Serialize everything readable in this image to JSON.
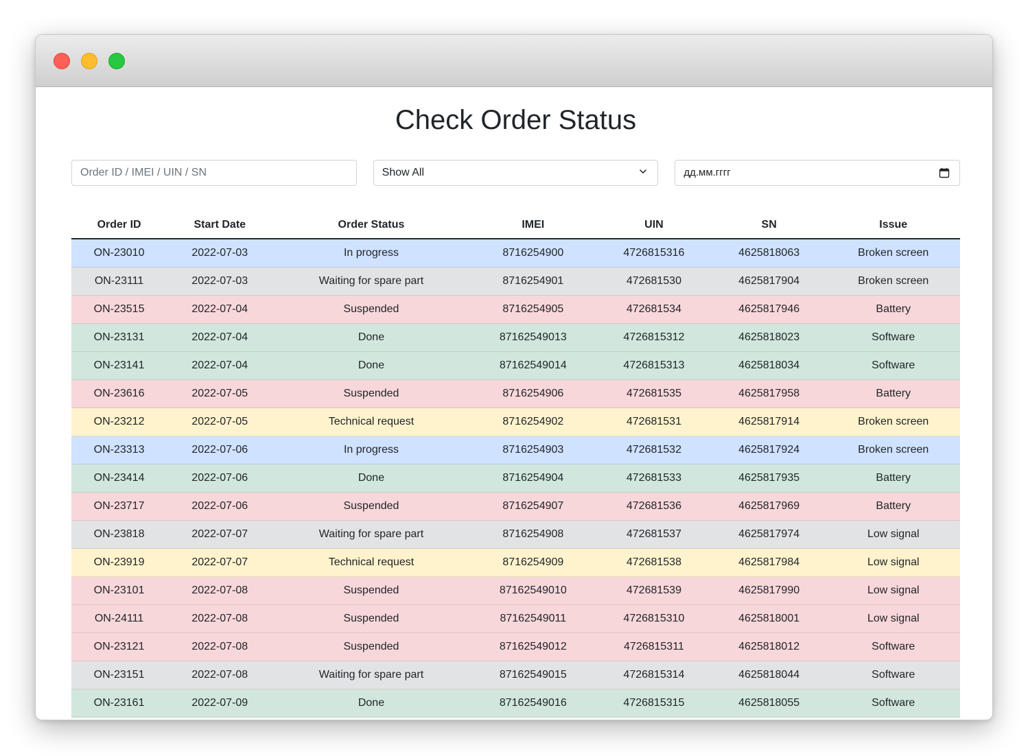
{
  "page": {
    "title": "Check Order Status"
  },
  "filters": {
    "search_placeholder": "Order ID / IMEI / UIN / SN",
    "status_selected": "Show All",
    "date_value": "дд.мм.гггг"
  },
  "table": {
    "headers": [
      "Order ID",
      "Start Date",
      "Order Status",
      "IMEI",
      "UIN",
      "SN",
      "Issue"
    ],
    "rows": [
      {
        "cells": [
          "ON-23010",
          "2022-07-03",
          "In progress",
          "8716254900",
          "4726815316",
          "4625818063",
          "Broken screen"
        ],
        "variant": "primary"
      },
      {
        "cells": [
          "ON-23111",
          "2022-07-03",
          "Waiting for spare part",
          "8716254901",
          "472681530",
          "4625817904",
          "Broken screen"
        ],
        "variant": "secondary"
      },
      {
        "cells": [
          "ON-23515",
          "2022-07-04",
          "Suspended",
          "8716254905",
          "472681534",
          "4625817946",
          "Battery"
        ],
        "variant": "danger"
      },
      {
        "cells": [
          "ON-23131",
          "2022-07-04",
          "Done",
          "87162549013",
          "4726815312",
          "4625818023",
          "Software"
        ],
        "variant": "success"
      },
      {
        "cells": [
          "ON-23141",
          "2022-07-04",
          "Done",
          "87162549014",
          "4726815313",
          "4625818034",
          "Software"
        ],
        "variant": "success"
      },
      {
        "cells": [
          "ON-23616",
          "2022-07-05",
          "Suspended",
          "8716254906",
          "472681535",
          "4625817958",
          "Battery"
        ],
        "variant": "danger"
      },
      {
        "cells": [
          "ON-23212",
          "2022-07-05",
          "Technical request",
          "8716254902",
          "472681531",
          "4625817914",
          "Broken screen"
        ],
        "variant": "warning"
      },
      {
        "cells": [
          "ON-23313",
          "2022-07-06",
          "In progress",
          "8716254903",
          "472681532",
          "4625817924",
          "Broken screen"
        ],
        "variant": "primary"
      },
      {
        "cells": [
          "ON-23414",
          "2022-07-06",
          "Done",
          "8716254904",
          "472681533",
          "4625817935",
          "Battery"
        ],
        "variant": "success"
      },
      {
        "cells": [
          "ON-23717",
          "2022-07-06",
          "Suspended",
          "8716254907",
          "472681536",
          "4625817969",
          "Battery"
        ],
        "variant": "danger"
      },
      {
        "cells": [
          "ON-23818",
          "2022-07-07",
          "Waiting for spare part",
          "8716254908",
          "472681537",
          "4625817974",
          "Low signal"
        ],
        "variant": "secondary"
      },
      {
        "cells": [
          "ON-23919",
          "2022-07-07",
          "Technical request",
          "8716254909",
          "472681538",
          "4625817984",
          "Low signal"
        ],
        "variant": "warning"
      },
      {
        "cells": [
          "ON-23101",
          "2022-07-08",
          "Suspended",
          "87162549010",
          "472681539",
          "4625817990",
          "Low signal"
        ],
        "variant": "danger"
      },
      {
        "cells": [
          "ON-24111",
          "2022-07-08",
          "Suspended",
          "87162549011",
          "4726815310",
          "4625818001",
          "Low signal"
        ],
        "variant": "danger"
      },
      {
        "cells": [
          "ON-23121",
          "2022-07-08",
          "Suspended",
          "87162549012",
          "4726815311",
          "4625818012",
          "Software"
        ],
        "variant": "danger"
      },
      {
        "cells": [
          "ON-23151",
          "2022-07-08",
          "Waiting for spare part",
          "87162549015",
          "4726815314",
          "4625818044",
          "Software"
        ],
        "variant": "secondary"
      },
      {
        "cells": [
          "ON-23161",
          "2022-07-09",
          "Done",
          "87162549016",
          "4726815315",
          "4625818055",
          "Software"
        ],
        "variant": "success"
      }
    ]
  },
  "status_colors": {
    "primary": "#cfe2ff",
    "secondary": "#e2e3e5",
    "danger": "#f8d7da",
    "success": "#d1e7dd",
    "warning": "#fff3cd"
  },
  "icons": {
    "window_controls": [
      "close-dot",
      "minimize-dot",
      "maximize-dot"
    ],
    "select": "chevron-down-icon",
    "date": "calendar-icon"
  }
}
